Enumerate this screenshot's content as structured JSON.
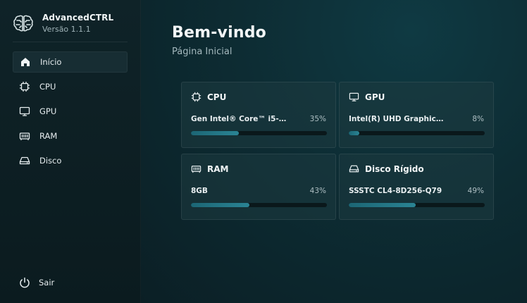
{
  "app": {
    "name": "AdvancedCTRL",
    "version": "Versão 1.1.1"
  },
  "sidebar": {
    "items": [
      {
        "label": "Início",
        "icon": "home-icon",
        "active": true
      },
      {
        "label": "CPU",
        "icon": "cpu-icon",
        "active": false
      },
      {
        "label": "GPU",
        "icon": "monitor-icon",
        "active": false
      },
      {
        "label": "RAM",
        "icon": "memory-icon",
        "active": false
      },
      {
        "label": "Disco",
        "icon": "hard-drive-icon",
        "active": false
      }
    ],
    "logout": {
      "label": "Sair",
      "icon": "power-icon"
    }
  },
  "main": {
    "title": "Bem-vindo",
    "subtitle": "Página Inicial",
    "cards": [
      {
        "title": "CPU",
        "icon": "cpu-icon",
        "device": "Gen Intel® Core™ i5-12...",
        "percent_label": "35%",
        "usage": 35
      },
      {
        "title": "GPU",
        "icon": "monitor-icon",
        "device": "Intel(R) UHD Graphics ...",
        "percent_label": "8%",
        "usage": 8
      },
      {
        "title": "RAM",
        "icon": "memory-icon",
        "device": "8GB",
        "percent_label": "43%",
        "usage": 43
      },
      {
        "title": "Disco Rígido",
        "icon": "hard-drive-icon",
        "device": "SSSTC CL4-8D256-Q79",
        "percent_label": "49%",
        "usage": 49
      }
    ]
  },
  "colors": {
    "accent": "#2a8494",
    "sidebar_bg": "#0f2328",
    "main_bg": "#0d2c33"
  }
}
